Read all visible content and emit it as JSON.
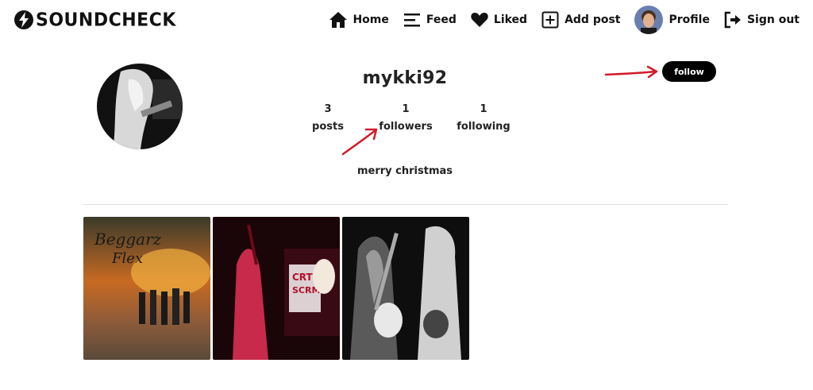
{
  "brand": {
    "name": "SOUNDCHECK"
  },
  "nav": {
    "home": "Home",
    "feed": "Feed",
    "liked": "Liked",
    "add_post": "Add post",
    "profile": "Profile",
    "sign_out": "Sign out"
  },
  "profile": {
    "username": "mykki92",
    "follow_label": "follow",
    "stats": {
      "posts": {
        "count": "3",
        "label": "posts"
      },
      "followers": {
        "count": "1",
        "label": "followers"
      },
      "following": {
        "count": "1",
        "label": "following"
      }
    },
    "bio": "merry christmas"
  },
  "colors": {
    "accent": "#000000",
    "annotation_arrow": "#d11a2a"
  }
}
